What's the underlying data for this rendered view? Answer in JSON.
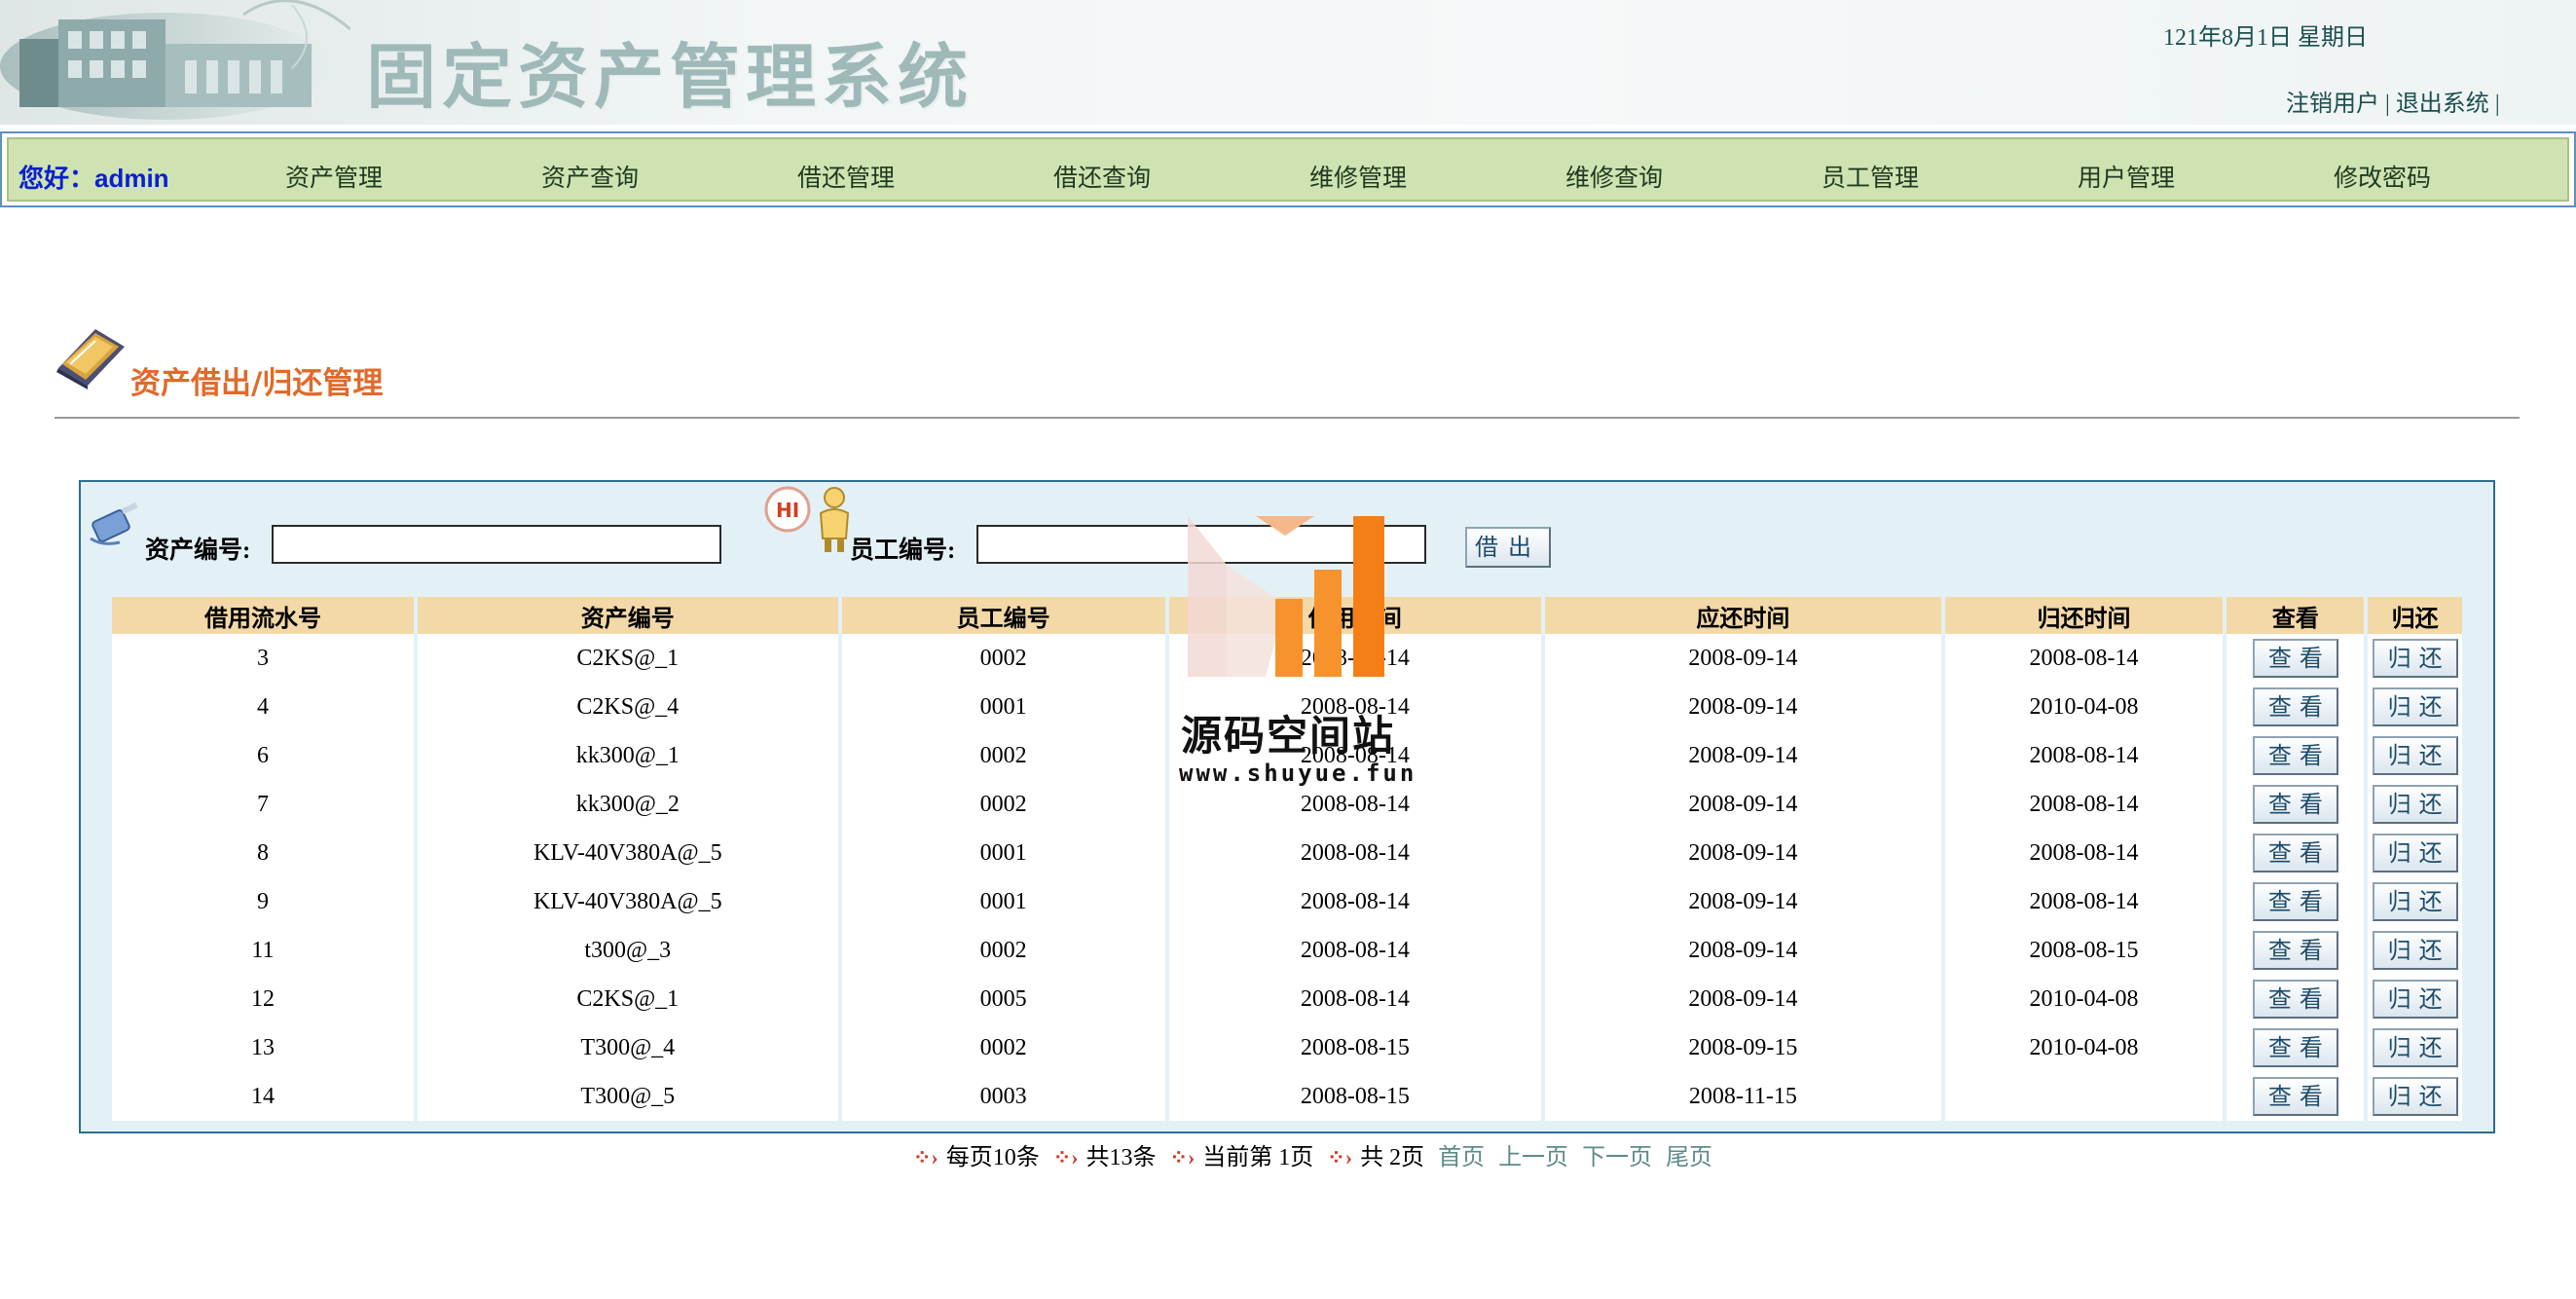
{
  "header": {
    "title": "固定资产管理系统",
    "date": "121年8月1日   星期日",
    "logout_label": "注销用户",
    "exit_label": "退出系统",
    "sep": "|"
  },
  "nav": {
    "greeting": "您好：admin",
    "items": [
      "资产管理",
      "资产查询",
      "借还管理",
      "借还查询",
      "维修管理",
      "维修查询",
      "员工管理",
      "用户管理",
      "修改密码"
    ]
  },
  "section": {
    "title": "资产借出/归还管理"
  },
  "form": {
    "asset_label": "资产编号:",
    "asset_value": "",
    "employee_label": "员工编号:",
    "employee_value": "",
    "borrow_button": "借出"
  },
  "table": {
    "headers": [
      "借用流水号",
      "资产编号",
      "员工编号",
      "借用时间",
      "应还时间",
      "归还时间",
      "查看",
      "归还"
    ],
    "view_label": "查看",
    "return_label": "归还",
    "rows": [
      [
        "3",
        "C2KS@_1",
        "0002",
        "2008-08-14",
        "2008-09-14",
        "2008-08-14"
      ],
      [
        "4",
        "C2KS@_4",
        "0001",
        "2008-08-14",
        "2008-09-14",
        "2010-04-08"
      ],
      [
        "6",
        "kk300@_1",
        "0002",
        "2008-08-14",
        "2008-09-14",
        "2008-08-14"
      ],
      [
        "7",
        "kk300@_2",
        "0002",
        "2008-08-14",
        "2008-09-14",
        "2008-08-14"
      ],
      [
        "8",
        "KLV-40V380A@_5",
        "0001",
        "2008-08-14",
        "2008-09-14",
        "2008-08-14"
      ],
      [
        "9",
        "KLV-40V380A@_5",
        "0001",
        "2008-08-14",
        "2008-09-14",
        "2008-08-14"
      ],
      [
        "11",
        "t300@_3",
        "0002",
        "2008-08-14",
        "2008-09-14",
        "2008-08-15"
      ],
      [
        "12",
        "C2KS@_1",
        "0005",
        "2008-08-14",
        "2008-09-14",
        "2010-04-08"
      ],
      [
        "13",
        "T300@_4",
        "0002",
        "2008-08-15",
        "2008-09-15",
        "2010-04-08"
      ],
      [
        "14",
        "T300@_5",
        "0003",
        "2008-08-15",
        "2008-11-15",
        ""
      ]
    ]
  },
  "pager": {
    "per_page": "每页10条",
    "total": "共13条",
    "current": "当前第 1页",
    "pages": "共 2页",
    "first": "首页",
    "prev": "上一页",
    "next": "下一页",
    "last": "尾页"
  },
  "watermark": {
    "name": "源码空间站",
    "url": "www.shuyue.fun"
  },
  "colors": {
    "nav_bg": "#cfe3b2",
    "greeting": "#0b1fd0",
    "section_title": "#e06a2a",
    "table_header": "#f3d8a8",
    "panel_bg": "#e3f1f7",
    "pager_arrow": "#d23a2a"
  },
  "icons": {
    "book": "book-icon",
    "plug": "plug-icon",
    "hi": "hi-person-icon",
    "arrow": "red-arrow-icon"
  }
}
